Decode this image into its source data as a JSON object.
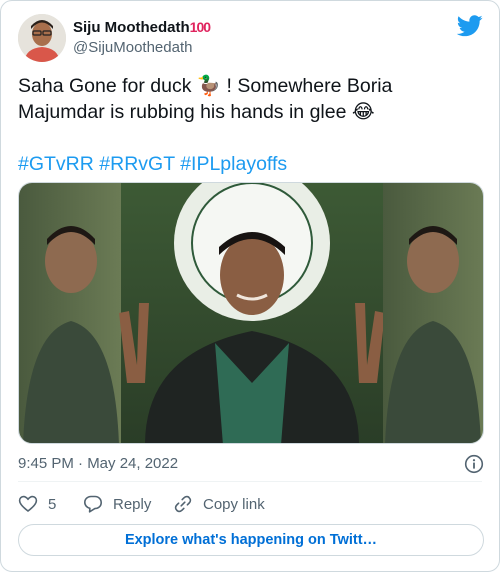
{
  "author": {
    "display_name": "Siju Moothedath",
    "badge": "100",
    "handle": "@SijuMoothedath"
  },
  "tweet": {
    "line1": "Saha Gone for duck 🦆 ! Somewhere Boria",
    "line2": "Majumdar is rubbing his hands in glee 😂",
    "hashtags": [
      "#GTvRR",
      "#RRvGT",
      "#IPLplayoffs"
    ]
  },
  "meta": {
    "timestamp": "9:45 PM · May 24, 2022"
  },
  "actions": {
    "like_count": "5",
    "reply_label": "Reply",
    "copy_link_label": "Copy link"
  },
  "explore_label": "Explore what's happening on Twitt…",
  "colors": {
    "brand": "#1d9bf0",
    "like": "#536471",
    "text": "#0f1419",
    "muted": "#536471"
  },
  "icons": [
    "twitter-bird-icon",
    "info-icon",
    "heart-icon",
    "reply-bubble-icon",
    "link-icon"
  ]
}
